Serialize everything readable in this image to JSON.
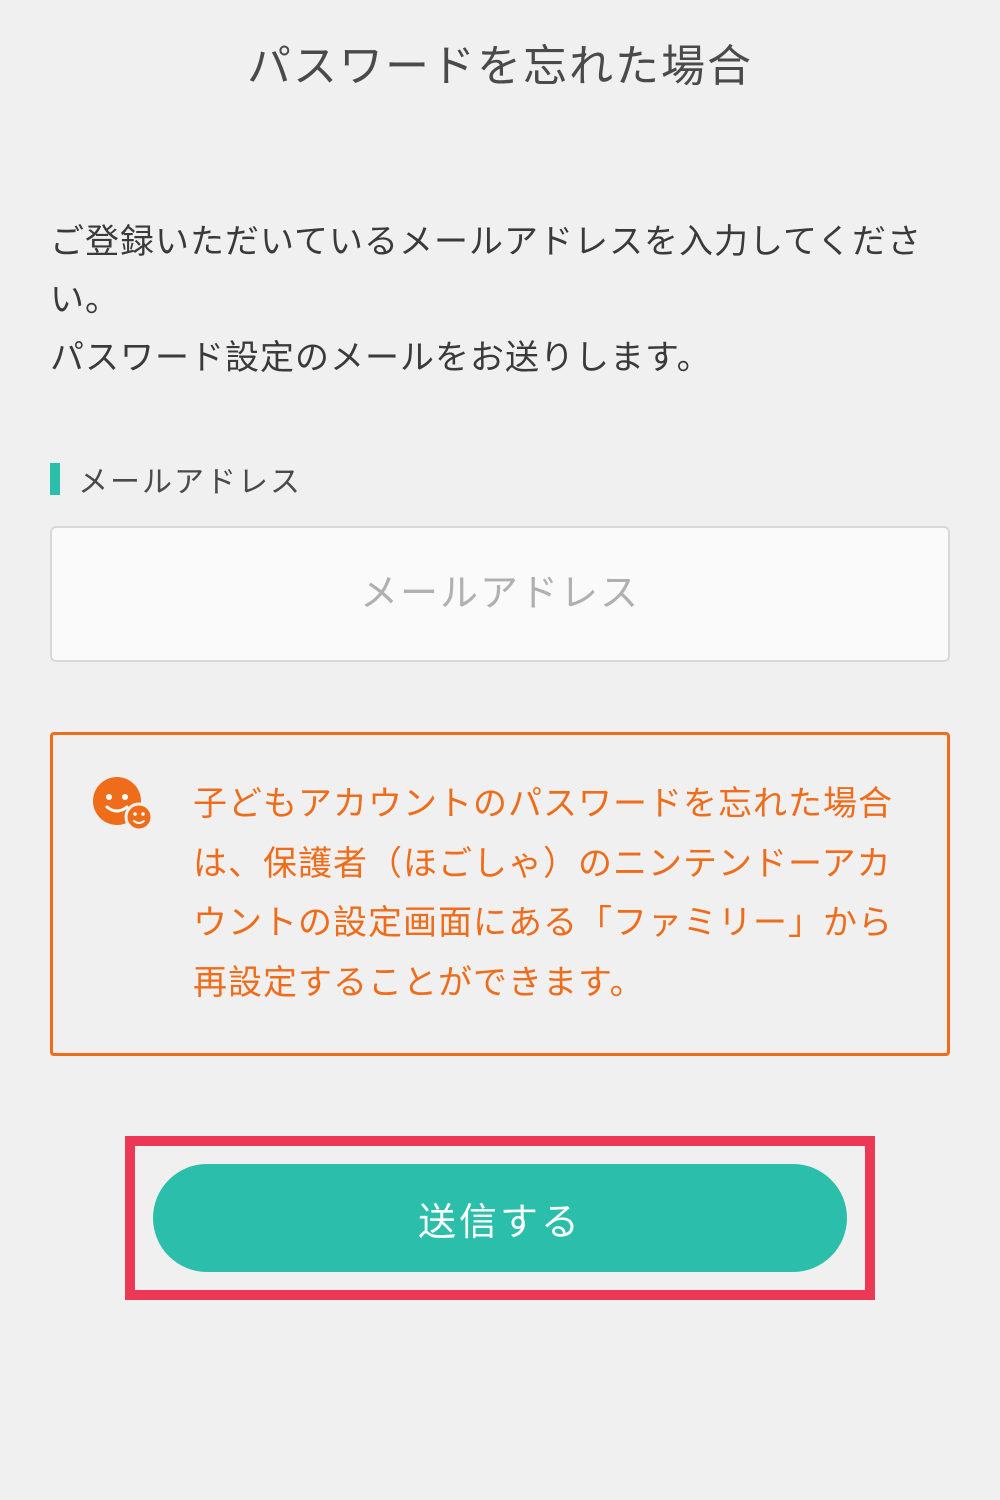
{
  "page": {
    "title": "パスワードを忘れた場合"
  },
  "instruction": {
    "line1": "ご登録いただいているメールアドレスを入力してください。",
    "line2": "パスワード設定のメールをお送りします。"
  },
  "emailField": {
    "label": "メールアドレス",
    "placeholder": "メールアドレス",
    "value": ""
  },
  "notice": {
    "text": "子どもアカウントのパスワードを忘れた場合は、保護者（ほごしゃ）のニンテンドーアカウントの設定画面にある「ファミリー」から再設定することができます。"
  },
  "submitButton": {
    "label": "送信する"
  },
  "colors": {
    "accent": "#2bbfab",
    "noticeOrange": "#ef6c1a",
    "highlightRed": "#ec3755"
  }
}
